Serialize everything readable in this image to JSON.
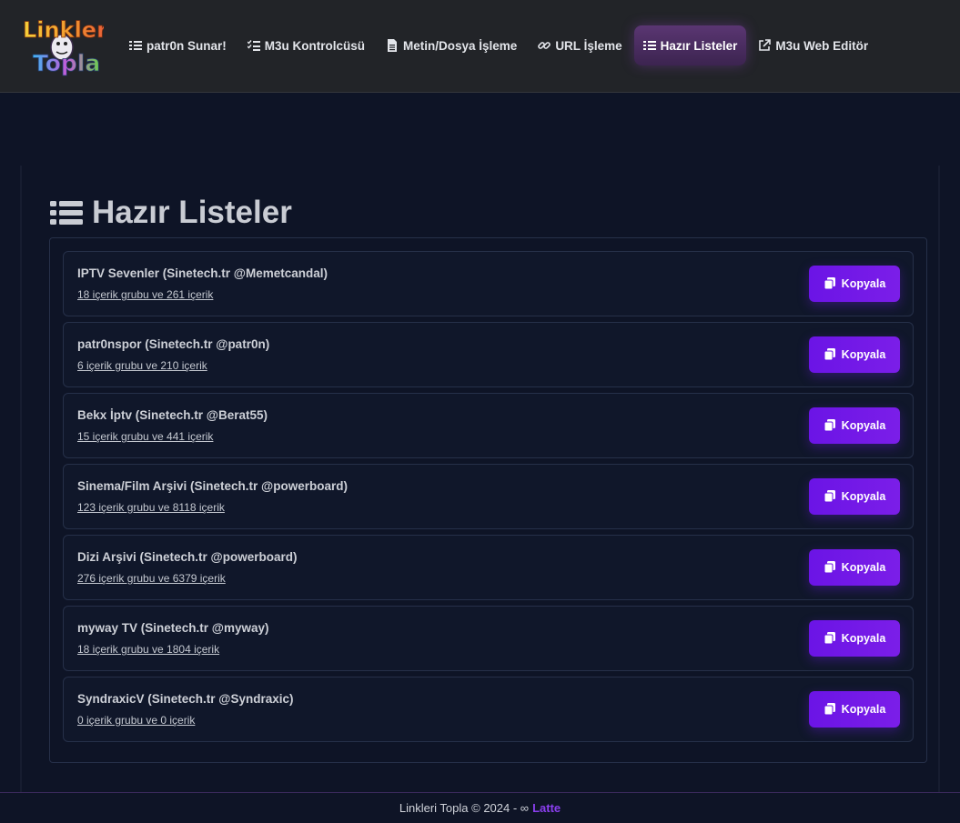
{
  "app": {
    "logo_text_top": "Linkleri",
    "logo_text_bottom": "Topla"
  },
  "nav": {
    "items": [
      {
        "label": "patr0n Sunar!",
        "icon": "list-icon",
        "active": false
      },
      {
        "label": "M3u Kontrolcüsü",
        "icon": "checklist-icon",
        "active": false
      },
      {
        "label": "Metin/Dosya İşleme",
        "icon": "file-icon",
        "active": false
      },
      {
        "label": "URL İşleme",
        "icon": "link-icon",
        "active": false
      },
      {
        "label": "Hazır Listeler",
        "icon": "list-icon",
        "active": true
      },
      {
        "label": "M3u Web Editör",
        "icon": "external-link-icon",
        "active": false
      }
    ]
  },
  "page": {
    "title": "Hazır Listeler",
    "title_icon": "list-icon"
  },
  "lists": [
    {
      "title": "IPTV Sevenler (Sinetech.tr @Memetcandal)",
      "summary": "18 içerik grubu ve 261 içerik",
      "button": "Kopyala"
    },
    {
      "title": "patr0nspor (Sinetech.tr @patr0n)",
      "summary": "6 içerik grubu ve 210 içerik",
      "button": "Kopyala"
    },
    {
      "title": "Bekx İptv (Sinetech.tr @Berat55)",
      "summary": "15 içerik grubu ve 441 içerik",
      "button": "Kopyala"
    },
    {
      "title": "Sinema/Film Arşivi (Sinetech.tr @powerboard)",
      "summary": "123 içerik grubu ve 8118 içerik",
      "button": "Kopyala"
    },
    {
      "title": "Dizi Arşivi (Sinetech.tr @powerboard)",
      "summary": "276 içerik grubu ve 6379 içerik",
      "button": "Kopyala"
    },
    {
      "title": "myway TV (Sinetech.tr @myway)",
      "summary": "18 içerik grubu ve 1804 içerik",
      "button": "Kopyala"
    },
    {
      "title": "SyndraxicV (Sinetech.tr @Syndraxic)",
      "summary": "0 içerik grubu ve 0 içerik",
      "button": "Kopyala"
    }
  ],
  "footer": {
    "text": "Linkleri Topla © 2024 - ∞",
    "brand": "Latte"
  },
  "colors": {
    "accent": "#7b1ee8",
    "background": "#0e1426",
    "navbar": "#222428",
    "active_nav": "#4a2d60"
  }
}
